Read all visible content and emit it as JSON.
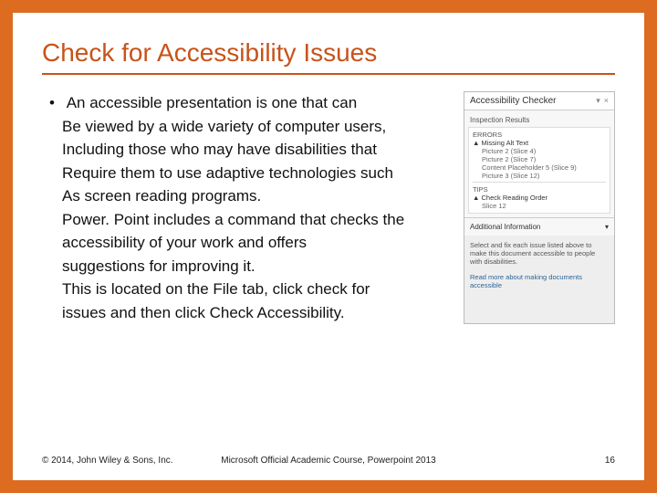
{
  "title": "Check for Accessibility Issues",
  "body": {
    "line1": "An accessible presentation is one that can",
    "line2": "Be viewed by a wide variety of computer users,",
    "line3": "Including those who may have disabilities that",
    "line4": "Require them to use adaptive technologies such",
    "line5": "As screen reading programs.",
    "line6": "Power. Point includes a command that checks the",
    "line7": "accessibility of your work and offers",
    "line8": "suggestions for improving it.",
    "line9": "This is located on the File tab, click check for",
    "line10": "issues and then click Check Accessibility."
  },
  "panel": {
    "title": "Accessibility Checker",
    "dropdown": "▾",
    "close": "×",
    "inspection_label": "Inspection Results",
    "errors_label": "ERRORS",
    "error_group": "Missing Alt Text",
    "error_items": [
      "Picture 2  (Slice 4)",
      "Picture 2  (Slice 7)",
      "Content Placeholder 5  (Slice 9)",
      "Picture 3  (Slice 12)"
    ],
    "tips_label": "TIPS",
    "tips_group": "Check Reading Order",
    "tips_items": [
      "Slice 12"
    ],
    "addl_label": "Additional Information",
    "addl_caret": "▾",
    "addl_text": "Select and fix each issue listed above to make this document accessible to people with disabilities.",
    "addl_link": "Read more about making documents accessible"
  },
  "footer": {
    "left": "© 2014, John Wiley & Sons, Inc.",
    "center": "Microsoft Official Academic Course, Powerpoint 2013",
    "right": "16"
  }
}
